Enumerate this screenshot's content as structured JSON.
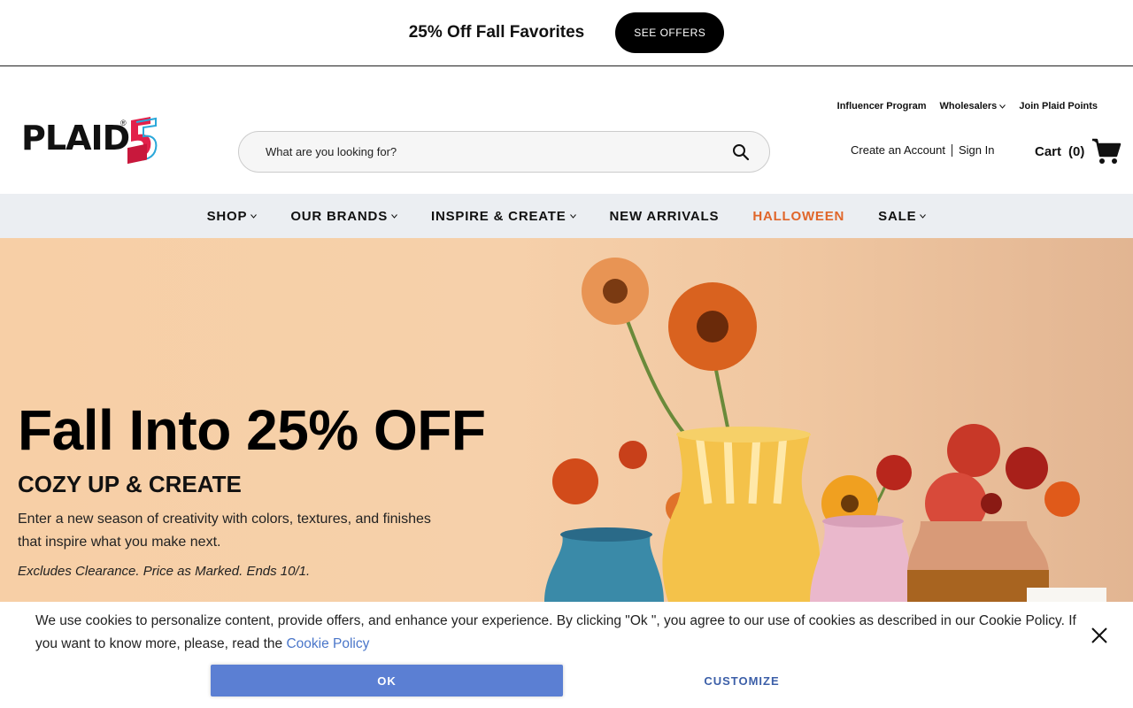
{
  "promo": {
    "text": "25% Off Fall Favorites",
    "button": "SEE OFFERS"
  },
  "header": {
    "logo_text": "PLAID",
    "logo_badge": "50",
    "search_placeholder": "What are you looking for?",
    "top_links": [
      "Influencer Program",
      "Wholesalers",
      "Join Plaid Points"
    ],
    "create_account": "Create an Account",
    "sign_in": "Sign In",
    "cart_label": "Cart",
    "cart_count": "(0)"
  },
  "nav": {
    "items": [
      {
        "label": "SHOP",
        "dropdown": true
      },
      {
        "label": "OUR BRANDS",
        "dropdown": true
      },
      {
        "label": "INSPIRE & CREATE",
        "dropdown": true
      },
      {
        "label": "NEW ARRIVALS",
        "dropdown": false
      },
      {
        "label": "HALLOWEEN",
        "dropdown": false,
        "color": "#e0662a"
      },
      {
        "label": "SALE",
        "dropdown": true
      }
    ]
  },
  "hero": {
    "title": "Fall Into 25% OFF",
    "subtitle": "COZY UP & CREATE",
    "description": "Enter a new season of creativity with colors, textures, and finishes that inspire what you make next.",
    "note": "Excludes Clearance. Price as Marked. Ends 10/1."
  },
  "cookie": {
    "text": "We use cookies to personalize content, provide offers, and enhance your experience. By clicking \"Ok \", you agree to our use of cookies as described in our Cookie Policy. If you want to know more, please, read the ",
    "link": "Cookie Policy",
    "ok": "OK",
    "customize": "CUSTOMIZE"
  },
  "colors": {
    "accent": "#e0662a",
    "ok_button": "#5b7fd3",
    "link": "#4a76c9",
    "nav_bg": "#ebeef2"
  }
}
